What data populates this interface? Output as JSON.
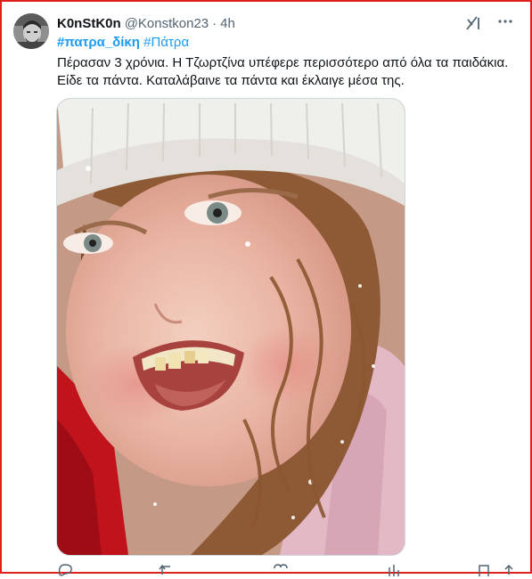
{
  "tweet": {
    "display_name": "K0nStK0n",
    "handle": "@Konstkon23",
    "separator": "·",
    "time": "4h",
    "hashtag_primary": "#πατρα_δίκη",
    "hashtag_secondary": "#Πάτρα",
    "text_line_1": "Πέρασαν 3 χρόνια. Η Τζωρτζίνα υπέφερε περισσότερο από όλα τα παιδάκια.",
    "text_line_2": "Είδε τα πάντα. Καταλάβαινε τα πάντα και έκλαιγε μέσα της."
  },
  "icons": {
    "grok": "grok-icon",
    "more": "more-icon",
    "reply": "reply-icon",
    "retweet": "retweet-icon",
    "like": "like-icon",
    "views": "views-icon",
    "bookmark": "bookmark-icon",
    "share": "share-icon"
  },
  "colors": {
    "frame": "#e0201b",
    "link": "#1d9bf0",
    "muted": "#536471",
    "text": "#0f1419"
  }
}
